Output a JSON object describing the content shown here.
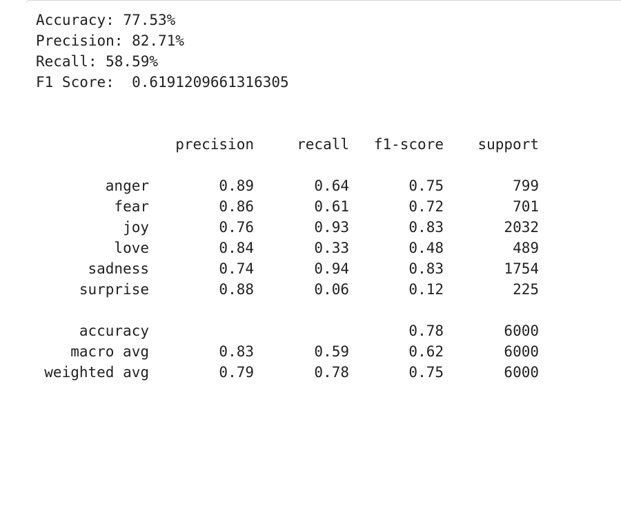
{
  "metrics": {
    "accuracy": "Accuracy: 77.53%",
    "precision": "Precision: 82.71%",
    "recall": "Recall: 58.59%",
    "f1": "F1 Score:  0.6191209661316305"
  },
  "report": {
    "headers": [
      "precision",
      "recall",
      "f1-score",
      "support"
    ],
    "classes": [
      {
        "label": "anger",
        "precision": "0.89",
        "recall": "0.64",
        "f1": "0.75",
        "support": "799"
      },
      {
        "label": "fear",
        "precision": "0.86",
        "recall": "0.61",
        "f1": "0.72",
        "support": "701"
      },
      {
        "label": "joy",
        "precision": "0.76",
        "recall": "0.93",
        "f1": "0.83",
        "support": "2032"
      },
      {
        "label": "love",
        "precision": "0.84",
        "recall": "0.33",
        "f1": "0.48",
        "support": "489"
      },
      {
        "label": "sadness",
        "precision": "0.74",
        "recall": "0.94",
        "f1": "0.83",
        "support": "1754"
      },
      {
        "label": "surprise",
        "precision": "0.88",
        "recall": "0.06",
        "f1": "0.12",
        "support": "225"
      }
    ],
    "accuracy_row": {
      "label": "accuracy",
      "precision": "",
      "recall": "",
      "f1": "0.78",
      "support": "6000"
    },
    "macro_avg": {
      "label": "macro avg",
      "precision": "0.83",
      "recall": "0.59",
      "f1": "0.62",
      "support": "6000"
    },
    "weighted_avg": {
      "label": "weighted avg",
      "precision": "0.79",
      "recall": "0.78",
      "f1": "0.75",
      "support": "6000"
    }
  }
}
